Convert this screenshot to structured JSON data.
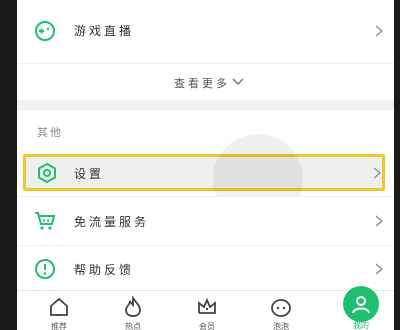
{
  "menu": {
    "game_live": {
      "label": "游戏直播",
      "icon": "game-controller-icon"
    },
    "see_more": {
      "label": "查看更多",
      "icon": "chevron-down-icon"
    }
  },
  "section": {
    "title": "其他"
  },
  "other_items": [
    {
      "label": "设置",
      "icon": "settings-hexagon-icon"
    },
    {
      "label": "免流量服务",
      "icon": "cart-icon"
    },
    {
      "label": "帮助反馈",
      "icon": "help-info-icon"
    }
  ],
  "tabbar": [
    {
      "label": "推荐",
      "icon": "home-icon"
    },
    {
      "label": "热点",
      "icon": "flame-icon"
    },
    {
      "label": "会员",
      "icon": "crown-icon"
    },
    {
      "label": "泡泡",
      "icon": "bubble-face-icon"
    },
    {
      "label": "我的",
      "icon": "profile-icon",
      "active": true
    }
  ],
  "colors": {
    "accent_green": "#1fbf6f",
    "highlight_border": "#f2c62d"
  }
}
